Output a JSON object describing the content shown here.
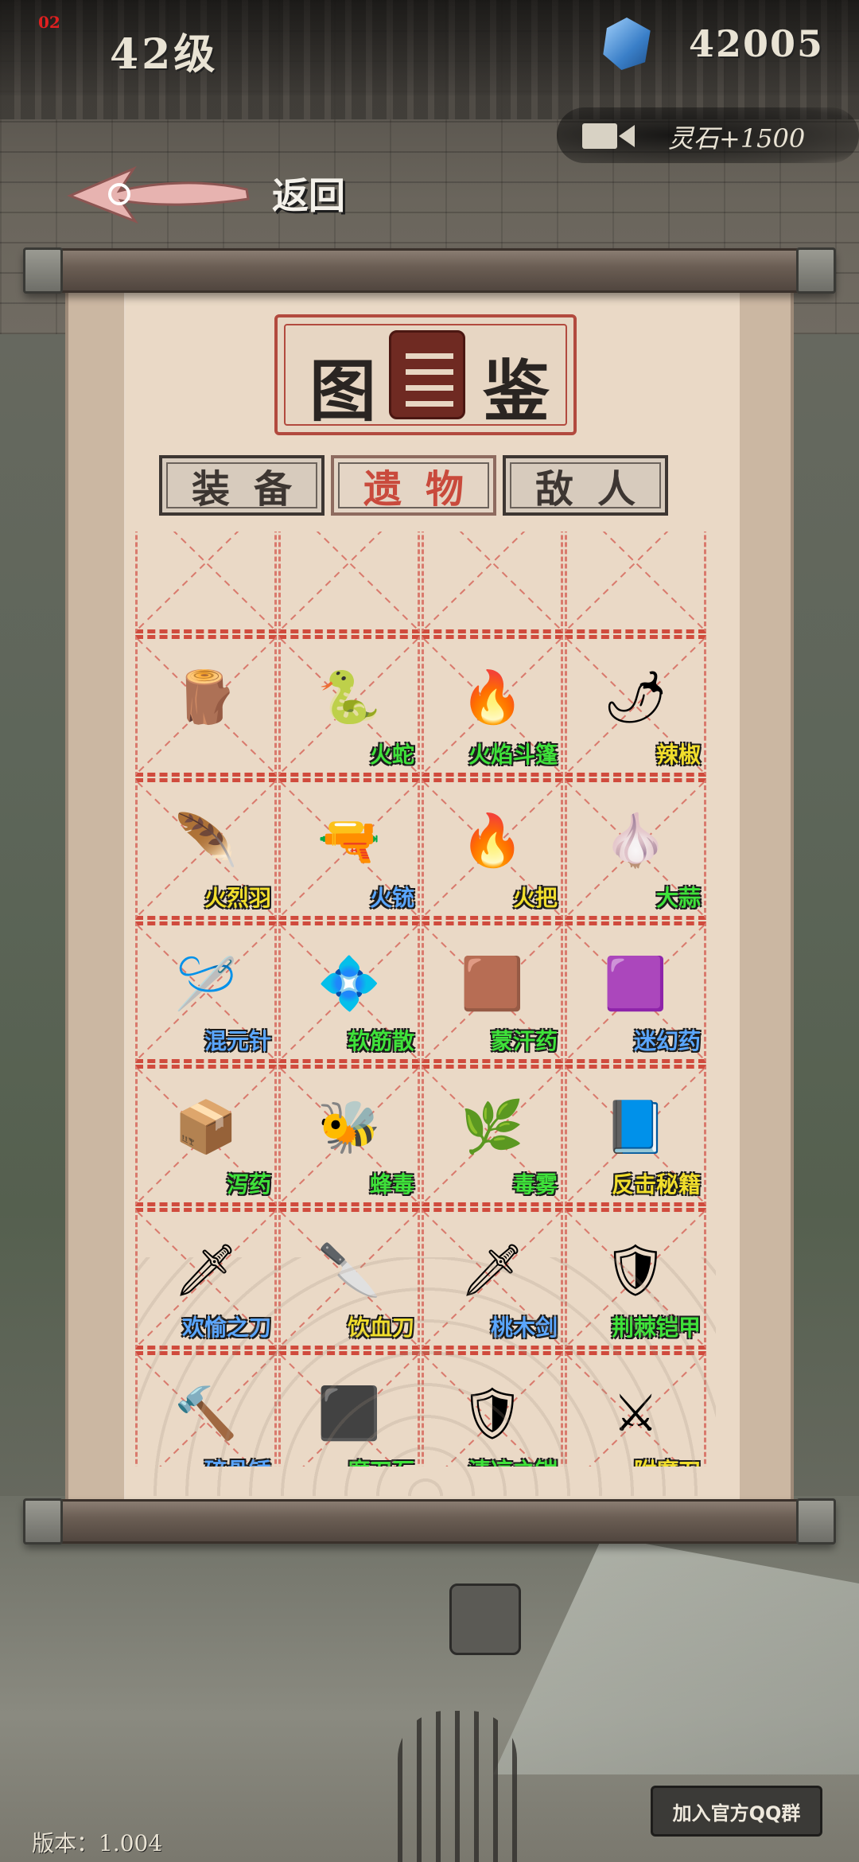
{
  "hud": {
    "level": "42级",
    "red_tag": "02",
    "spirit_stones": "42005"
  },
  "ad_reward": {
    "label": "灵石+1500",
    "icon": "video-camera-icon"
  },
  "back": {
    "label": "返回",
    "icon": "back-arrow-icon"
  },
  "title": {
    "left_char": "图",
    "right_char": "鉴",
    "icon": "book-icon"
  },
  "tabs": [
    {
      "label": "装备",
      "active": false
    },
    {
      "label": "遗物",
      "active": true
    },
    {
      "label": "敌人",
      "active": false
    }
  ],
  "colors": {
    "green": "#3fe23a",
    "blue": "#5aa6ff",
    "yellow": "#f1de2c",
    "dash_red": "#d04b3d"
  },
  "items": [
    {
      "name": "",
      "icon": "hidden-item-icon",
      "glyph": "",
      "color": "green"
    },
    {
      "name": "",
      "icon": "hidden-item-icon",
      "glyph": "",
      "color": "blue"
    },
    {
      "name": "",
      "icon": "hidden-item-icon",
      "glyph": "",
      "color": "green"
    },
    {
      "name": "",
      "icon": "hidden-item-icon",
      "glyph": "",
      "color": "yellow"
    },
    {
      "name": "",
      "icon": "club-icon",
      "glyph": "🪵",
      "color": "green"
    },
    {
      "name": "火蛇",
      "icon": "fire-snake-icon",
      "glyph": "🐍",
      "color": "green"
    },
    {
      "name": "火焰斗篷",
      "icon": "flame-cloak-icon",
      "glyph": "🔥",
      "color": "green"
    },
    {
      "name": "辣椒",
      "icon": "chili-pepper-icon",
      "glyph": "🌶",
      "color": "yellow"
    },
    {
      "name": "火烈羽",
      "icon": "fire-feather-icon",
      "glyph": "🪶",
      "color": "yellow"
    },
    {
      "name": "火铳",
      "icon": "musket-icon",
      "glyph": "🔫",
      "color": "blue"
    },
    {
      "name": "火把",
      "icon": "torch-icon",
      "glyph": "🔥",
      "color": "yellow"
    },
    {
      "name": "大蒜",
      "icon": "garlic-icon",
      "glyph": "🧄",
      "color": "green"
    },
    {
      "name": "混元针",
      "icon": "needle-icon",
      "glyph": "🪡",
      "color": "blue"
    },
    {
      "name": "软筋散",
      "icon": "powder-packet-icon",
      "glyph": "💠",
      "color": "green"
    },
    {
      "name": "蒙汗药",
      "icon": "drug-packet-icon",
      "glyph": "🟫",
      "color": "green"
    },
    {
      "name": "迷幻药",
      "icon": "hallucinogen-icon",
      "glyph": "🟪",
      "color": "blue"
    },
    {
      "name": "泻药",
      "icon": "laxative-icon",
      "glyph": "📦",
      "color": "green"
    },
    {
      "name": "蜂毒",
      "icon": "bee-venom-icon",
      "glyph": "🐝",
      "color": "green"
    },
    {
      "name": "毒雾",
      "icon": "poison-fog-icon",
      "glyph": "🌿",
      "color": "green"
    },
    {
      "name": "反击秘籍",
      "icon": "secret-book-icon",
      "glyph": "📘",
      "color": "yellow"
    },
    {
      "name": "欢愉之刀",
      "icon": "joy-blade-icon",
      "glyph": "🗡",
      "color": "blue"
    },
    {
      "name": "饮血刀",
      "icon": "blood-blade-icon",
      "glyph": "🔪",
      "color": "yellow"
    },
    {
      "name": "桃木剑",
      "icon": "peach-wood-sword-icon",
      "glyph": "🗡",
      "color": "blue"
    },
    {
      "name": "荆棘铠甲",
      "icon": "thorn-armor-icon",
      "glyph": "🛡",
      "color": "green"
    },
    {
      "name": "碎骨锤",
      "icon": "bone-hammer-icon",
      "glyph": "🔨",
      "color": "blue"
    },
    {
      "name": "磨刀石",
      "icon": "whetstone-icon",
      "glyph": "⬛",
      "color": "green"
    },
    {
      "name": "清凉之铠",
      "icon": "cool-armor-icon",
      "glyph": "🛡",
      "color": "green"
    },
    {
      "name": "附魔刀",
      "icon": "enchanted-blade-icon",
      "glyph": "⚔",
      "color": "yellow"
    },
    {
      "name": "",
      "icon": "partial-item-icon",
      "glyph": "",
      "color": "blue"
    },
    {
      "name": "",
      "icon": "partial-item-icon",
      "glyph": "",
      "color": "blue"
    },
    {
      "name": "",
      "icon": "partial-item-icon",
      "glyph": "",
      "color": "blue"
    },
    {
      "name": "",
      "icon": "partial-item-icon",
      "glyph": "",
      "color": "blue"
    }
  ],
  "footer": {
    "qq_button": "加入官方QQ群",
    "version": "版本：1.004"
  }
}
